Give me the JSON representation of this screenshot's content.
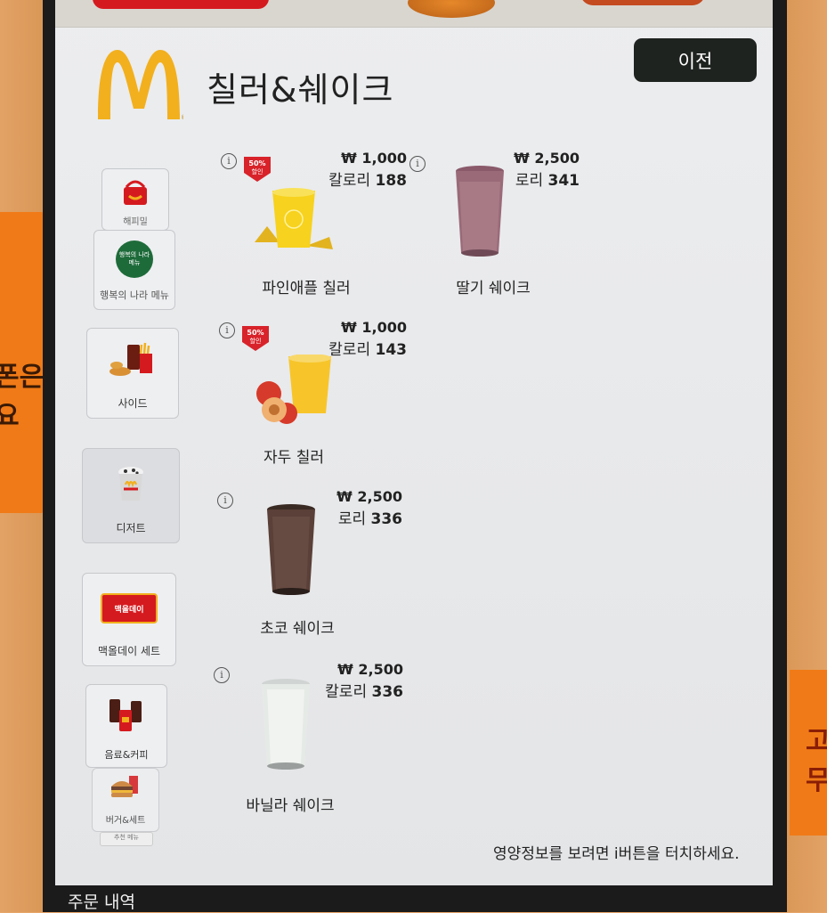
{
  "header": {
    "title": "칠러&쉐이크",
    "back_label": "이전"
  },
  "sidebar": {
    "items": [
      {
        "label": "해피밀",
        "icon": "happy-meal-icon"
      },
      {
        "label": "행복의 나라 메뉴",
        "icon_text": "행복의 나라 메뉴",
        "icon": "happy-country-icon"
      },
      {
        "label": "사이드",
        "icon": "side-menu-icon"
      },
      {
        "label": "디저트",
        "icon": "dessert-icon",
        "active": true
      },
      {
        "label": "맥올데이 세트",
        "icon_text": "맥올데이",
        "icon": "mcallday-icon"
      },
      {
        "label": "음료&커피",
        "icon": "drink-coffee-icon"
      },
      {
        "label": "버거&세트",
        "icon": "burger-set-icon"
      },
      {
        "label": "추천 메뉴"
      }
    ]
  },
  "products": [
    {
      "name": "파인애플 칠러",
      "price": "₩ 1,000",
      "cal_label": "칼로리",
      "cal_value": "188",
      "badge": "50% 할인",
      "icon": "pineapple-chiller-icon"
    },
    {
      "name": "딸기 쉐이크",
      "price": "₩ 2,500",
      "cal_label": "로리",
      "cal_value": "341",
      "icon": "strawberry-shake-icon"
    },
    {
      "name": "자두 칠러",
      "price": "₩ 1,000",
      "cal_label": "칼로리",
      "cal_value": "143",
      "badge": "50% 할인",
      "icon": "plum-chiller-icon"
    },
    {
      "name": "초코 쉐이크",
      "price": "₩ 2,500",
      "cal_label": "로리",
      "cal_value": "336",
      "icon": "choco-shake-icon"
    },
    {
      "name": "바닐라 쉐이크",
      "price": "₩ 2,500",
      "cal_label": "칼로리",
      "cal_value": "336",
      "icon": "vanilla-shake-icon"
    }
  ],
  "info_glyph": "i",
  "footer": {
    "hint": "영양정보를 보려면 i버튼을 터치하세요.",
    "order_label": "주문 내역"
  },
  "posters": {
    "left_text": "폰은요",
    "right_text": "고무"
  },
  "colors": {
    "brand_yellow": "#f2b01e",
    "badge_red": "#d8232a",
    "button_dark": "#1f2320"
  }
}
